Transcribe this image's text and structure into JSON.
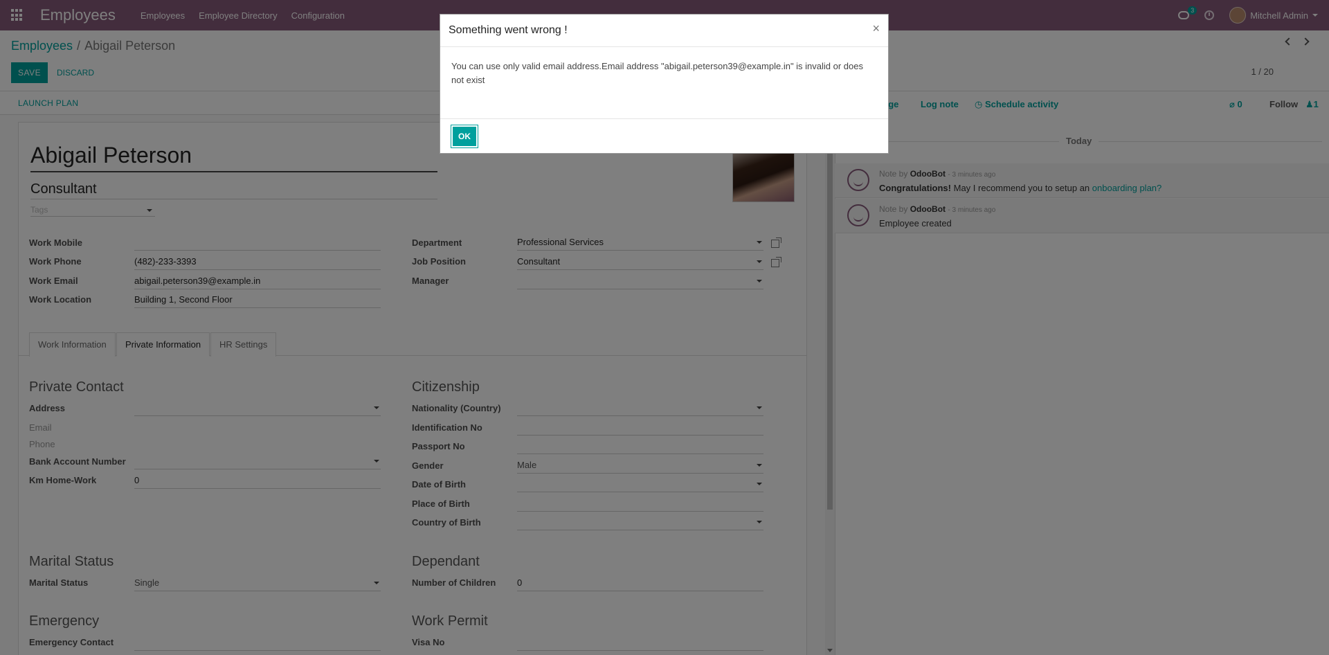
{
  "navbar": {
    "app_name": "Employees",
    "menu": [
      "Employees",
      "Employee Directory",
      "Configuration"
    ],
    "chat_badge": "3",
    "user_name": "Mitchell Admin"
  },
  "breadcrumb": {
    "root": "Employees",
    "separator": "/",
    "current": "Abigail Peterson"
  },
  "toolbar": {
    "save_label": "SAVE",
    "discard_label": "DISCARD"
  },
  "pager": {
    "value": "1 / 20"
  },
  "statusbar": {
    "launch_plan": "LAUNCH PLAN"
  },
  "employee": {
    "name": "Abigail Peterson",
    "job_title": "Consultant",
    "tags_placeholder": "Tags"
  },
  "fields_left": [
    {
      "label": "Work Mobile",
      "value": ""
    },
    {
      "label": "Work Phone",
      "value": "(482)-233-3393"
    },
    {
      "label": "Work Email",
      "value": "abigail.peterson39@example.in"
    },
    {
      "label": "Work Location",
      "value": "Building 1, Second Floor"
    }
  ],
  "fields_right": [
    {
      "label": "Department",
      "value": "Professional Services"
    },
    {
      "label": "Job Position",
      "value": "Consultant"
    },
    {
      "label": "Manager",
      "value": ""
    }
  ],
  "tabs": [
    "Work Information",
    "Private Information",
    "HR Settings"
  ],
  "private_contact": {
    "title": "Private Contact",
    "address_label": "Address",
    "email_label": "Email",
    "phone_label": "Phone",
    "bank_label": "Bank Account Number",
    "km_label": "Km Home-Work",
    "km_value": "0"
  },
  "citizenship": {
    "title": "Citizenship",
    "nationality_label": "Nationality (Country)",
    "id_label": "Identification No",
    "passport_label": "Passport No",
    "gender_label": "Gender",
    "gender_value": "Male",
    "dob_label": "Date of Birth",
    "pob_label": "Place of Birth",
    "cob_label": "Country of Birth"
  },
  "marital": {
    "title": "Marital Status",
    "label": "Marital Status",
    "value": "Single"
  },
  "dependant": {
    "title": "Dependant",
    "label": "Number of Children",
    "value": "0"
  },
  "emergency": {
    "title": "Emergency",
    "contact_label": "Emergency Contact"
  },
  "work_permit": {
    "title": "Work Permit",
    "visa_label": "Visa No"
  },
  "chatter": {
    "send_message_partial": "age",
    "log_note": "Log note",
    "schedule_activity": "Schedule activity",
    "attachments": "0",
    "follow": "Follow",
    "followers": "1",
    "day": "Today",
    "messages": [
      {
        "prefix": "Note by",
        "author": "OdooBot",
        "ago": "- 3 minutes ago",
        "bold": "Congratulations!",
        "text": " May I recommend you to setup an ",
        "link": "onboarding plan?"
      },
      {
        "prefix": "Note by",
        "author": "OdooBot",
        "ago": "- 3 minutes ago",
        "bold": "",
        "text": "Employee created",
        "link": ""
      }
    ]
  },
  "modal": {
    "title": "Something went wrong !",
    "close": "×",
    "message": "You can use only valid email address.Email address \"abigail.peterson39@example.in\" is invalid or does not exist",
    "ok_label": "OK"
  },
  "colors": {
    "brand": "#875a7b",
    "accent": "#00a09d"
  }
}
